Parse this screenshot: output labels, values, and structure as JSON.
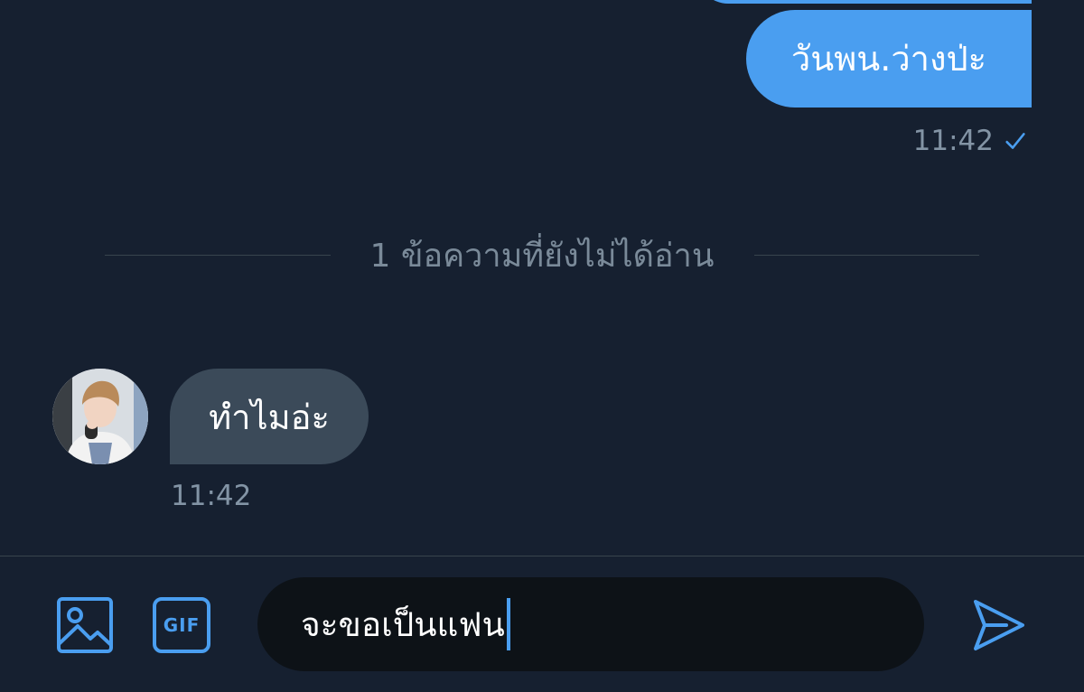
{
  "thread": {
    "outgoing_message": {
      "text": "วันพน.ว่างป่ะ",
      "time": "11:42",
      "status_icon": "check-icon"
    },
    "unread_divider": {
      "text": "1 ข้อความที่ยังไม่ได้อ่าน"
    },
    "incoming_message": {
      "text": "ทำไมอ่ะ",
      "time": "11:42",
      "avatar_icon": "avatar"
    }
  },
  "composer": {
    "input_value": "จะขอเป็นแฟน",
    "image_icon": "image-icon",
    "gif_label": "GIF",
    "send_icon": "send-icon"
  },
  "colors": {
    "background": "#162030",
    "accent": "#4a9ef0",
    "incoming_bubble": "#3b4a59",
    "muted_text": "#8394a5",
    "input_background": "#0d1217"
  }
}
